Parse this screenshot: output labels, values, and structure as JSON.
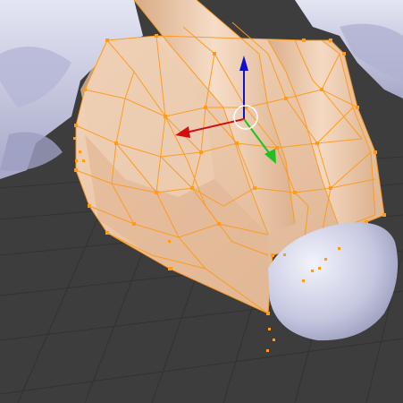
{
  "viewport": {
    "background_color": "#3d3d3d",
    "grid_line_color": "#333333",
    "mesh_shading_color": "#e7c7a8",
    "unselected_mesh_color": "#c9cbe6",
    "selection_color": "#ff9a1a",
    "gizmo": {
      "x_axis_color": "#d01010",
      "y_axis_color": "#20c020",
      "z_axis_color": "#1010d0",
      "center_ring_color": "#ffffff"
    }
  }
}
